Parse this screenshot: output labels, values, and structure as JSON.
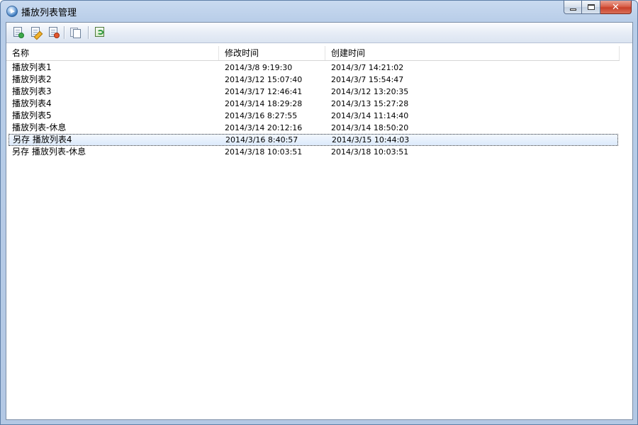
{
  "window": {
    "title": "播放列表管理"
  },
  "toolbar": {
    "buttons": [
      {
        "name": "add-playlist",
        "icon": "document-add-icon"
      },
      {
        "name": "edit-playlist",
        "icon": "document-edit-icon"
      },
      {
        "name": "delete-playlist",
        "icon": "document-delete-icon"
      },
      {
        "name": "copy-playlist",
        "icon": "copy-icon"
      },
      {
        "name": "refresh-playlist",
        "icon": "refresh-icon"
      }
    ]
  },
  "table": {
    "columns": [
      "名称",
      "修改时间",
      "创建时间"
    ],
    "selected_index": 6,
    "rows": [
      {
        "name": "播放列表1",
        "modified": "2014/3/8 9:19:30",
        "created": "2014/3/7 14:21:02"
      },
      {
        "name": "播放列表2",
        "modified": "2014/3/12 15:07:40",
        "created": "2014/3/7 15:54:47"
      },
      {
        "name": "播放列表3",
        "modified": "2014/3/17 12:46:41",
        "created": "2014/3/12 13:20:35"
      },
      {
        "name": "播放列表4",
        "modified": "2014/3/14 18:29:28",
        "created": "2014/3/13 15:27:28"
      },
      {
        "name": "播放列表5",
        "modified": "2014/3/16 8:27:55",
        "created": "2014/3/14 11:14:40"
      },
      {
        "name": "播放列表-休息",
        "modified": "2014/3/14 20:12:16",
        "created": "2014/3/14 18:50:20"
      },
      {
        "name": "另存 播放列表4",
        "modified": "2014/3/16 8:40:57",
        "created": "2014/3/15 10:44:03"
      },
      {
        "name": "另存 播放列表-休息",
        "modified": "2014/3/18 10:03:51",
        "created": "2014/3/18 10:03:51"
      }
    ]
  }
}
